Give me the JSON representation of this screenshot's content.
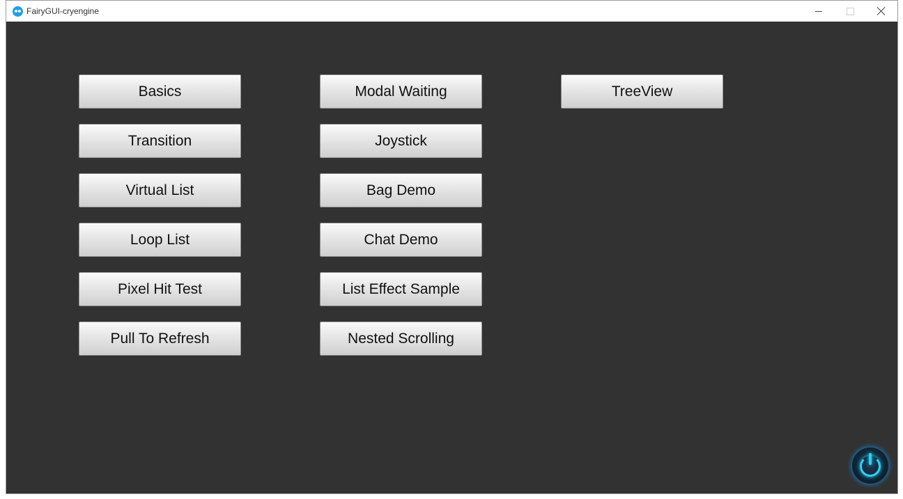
{
  "window": {
    "title": "FairyGUI-cryengine"
  },
  "buttons": {
    "basics": "Basics",
    "transition": "Transition",
    "virtual_list": "Virtual List",
    "loop_list": "Loop List",
    "pixel_hit_test": "Pixel Hit Test",
    "pull_to_refresh": "Pull To Refresh",
    "modal_waiting": "Modal Waiting",
    "joystick": "Joystick",
    "bag_demo": "Bag Demo",
    "chat_demo": "Chat Demo",
    "list_effect_sample": "List Effect Sample",
    "nested_scrolling": "Nested Scrolling",
    "tree_view": "TreeView"
  },
  "icons": {
    "app": "fairygui-logo-icon",
    "power": "power-icon"
  },
  "colors": {
    "background": "#323232",
    "power_glow": "#2fd0f5"
  }
}
